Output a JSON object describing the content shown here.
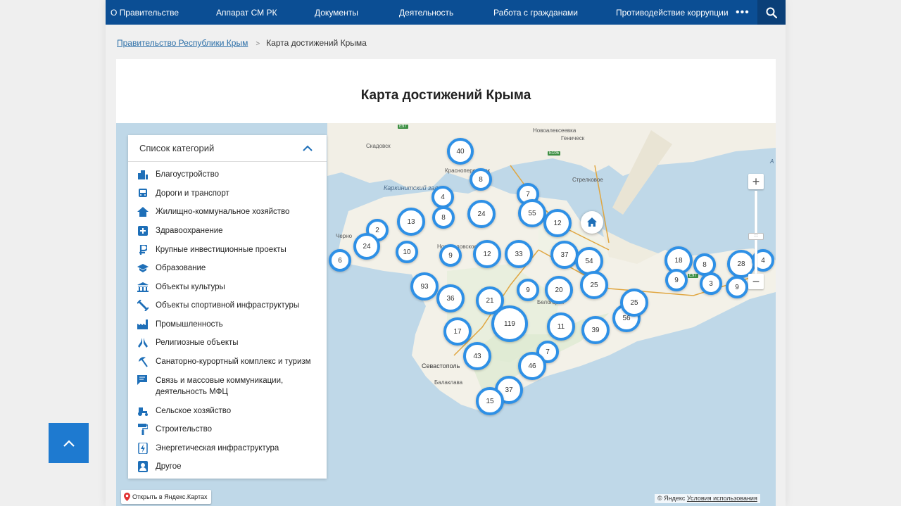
{
  "nav": {
    "items": [
      "О Правительстве",
      "Аппарат СМ РК",
      "Документы",
      "Деятельность",
      "Работа с гражданами",
      "Противодействие коррупции"
    ],
    "more": "•••"
  },
  "breadcrumb": {
    "parent": "Правительство Республики Крым",
    "separator": ">",
    "current": "Карта достижений Крыма"
  },
  "page_title": "Карта достижений Крыма",
  "categories": {
    "header": "Список категорий",
    "items": [
      {
        "label": "Благоустройство",
        "icon": "buildings-icon"
      },
      {
        "label": "Дороги и транспорт",
        "icon": "bus-icon"
      },
      {
        "label": "Жилищно-коммунальное хозяйство",
        "icon": "house-icon"
      },
      {
        "label": "Здравоохранение",
        "icon": "medical-cross-icon"
      },
      {
        "label": "Крупные инвестиционные проекты",
        "icon": "ruble-icon"
      },
      {
        "label": "Образование",
        "icon": "graduation-cap-icon"
      },
      {
        "label": "Объекты культуры",
        "icon": "museum-icon"
      },
      {
        "label": "Объекты спортивной инфраструктуры",
        "icon": "dumbbell-icon"
      },
      {
        "label": "Промышленность",
        "icon": "factory-icon"
      },
      {
        "label": "Религиозные объекты",
        "icon": "praying-hands-icon"
      },
      {
        "label": "Санаторно-курортный комплекс и туризм",
        "icon": "beach-umbrella-icon"
      },
      {
        "label": "Связь и массовые коммуникации, деятельность МФЦ",
        "icon": "chat-icon"
      },
      {
        "label": "Сельское хозяйство",
        "icon": "tractor-icon"
      },
      {
        "label": "Строительство",
        "icon": "paint-roller-icon"
      },
      {
        "label": "Энергетическая инфраструктура",
        "icon": "energy-icon"
      },
      {
        "label": "Другое",
        "icon": "person-badge-icon"
      }
    ]
  },
  "map": {
    "place_labels": [
      "Новоалексеевка",
      "Геническ",
      "Скадовск",
      "Стрелковое",
      "Каркинитский залив",
      "Черно",
      "Красноперекопск",
      "Новоселовское",
      "Белогорск",
      "Севастополь",
      "Балаклава",
      "А"
    ],
    "road_labels": [
      "E97",
      "E105",
      "E97"
    ],
    "clusters": [
      40,
      8,
      4,
      7,
      55,
      24,
      13,
      8,
      12,
      2,
      24,
      10,
      6,
      9,
      12,
      33,
      37,
      54,
      18,
      8,
      28,
      4,
      9,
      3,
      9,
      93,
      36,
      21,
      9,
      20,
      25,
      56,
      25,
      17,
      119,
      11,
      39,
      43,
      7,
      46,
      37,
      15
    ],
    "zoom_in": "+",
    "zoom_out": "−",
    "zoom_handle": "::::",
    "open_in_yandex": "Открыть в Яндекс.Картах",
    "copyright": "© Яндекс",
    "terms": "Условия использования"
  },
  "colors": {
    "nav_bg": "#0b4e94",
    "cluster_ring": "#2e90e6",
    "to_top_bg": "#1e7ad0"
  }
}
